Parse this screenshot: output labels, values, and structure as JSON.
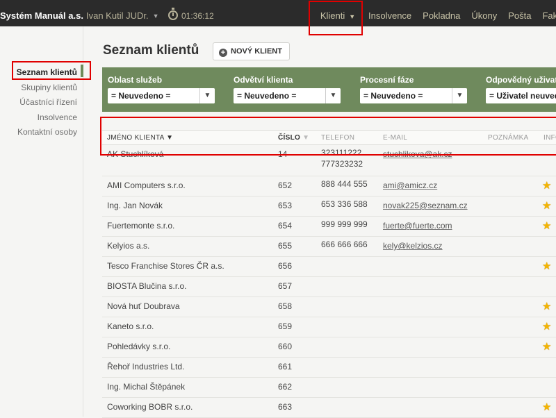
{
  "topbar": {
    "brand": "Systém Manuál a.s.",
    "user": "Ivan Kutil JUDr.",
    "timer": "01:36:12",
    "nav": [
      "Klienti",
      "Insolvence",
      "Pokladna",
      "Úkony",
      "Pošta",
      "Faktur"
    ]
  },
  "sidebar": {
    "items": [
      "Seznam klientů",
      "Skupiny klientů",
      "Účastníci řízení",
      "Insolvence",
      "Kontaktní osoby"
    ]
  },
  "main": {
    "title": "Seznam klientů",
    "new_button": "NOVÝ KLIENT"
  },
  "filters": [
    {
      "label": "Oblast služeb",
      "value": "= Neuvedeno ="
    },
    {
      "label": "Odvětví klienta",
      "value": "= Neuvedeno ="
    },
    {
      "label": "Procesní fáze",
      "value": "= Neuvedeno ="
    },
    {
      "label": "Odpovědný uživatel",
      "value": "= Uživatel neuvedeno"
    }
  ],
  "table": {
    "headers": {
      "name": "JMÉNO KLIENTA",
      "number": "ČÍSLO",
      "phone": "TELEFON",
      "email": "E-MAIL",
      "note": "POZNÁMKA",
      "info": "INFO"
    },
    "rows": [
      {
        "name": "AK Stuchlíková",
        "number": "14",
        "phone": "323111222",
        "phone2": "777323232",
        "email": "stuchlikova@ak.cz",
        "star": false
      },
      {
        "name": "AMI Computers s.r.o.",
        "number": "652",
        "phone": "888 444 555",
        "phone2": "",
        "email": "ami@amicz.cz",
        "star": true
      },
      {
        "name": "Ing. Jan Novák",
        "number": "653",
        "phone": "653 336 588",
        "phone2": "",
        "email": "novak225@seznam.cz",
        "star": true
      },
      {
        "name": "Fuertemonte s.r.o.",
        "number": "654",
        "phone": "999 999 999",
        "phone2": "",
        "email": "fuerte@fuerte.com",
        "star": true
      },
      {
        "name": "Kelyios a.s.",
        "number": "655",
        "phone": "666 666 666",
        "phone2": "",
        "email": "kely@kelzios.cz",
        "star": false
      },
      {
        "name": "Tesco Franchise Stores ČR a.s.",
        "number": "656",
        "phone": "",
        "phone2": "",
        "email": "",
        "star": true
      },
      {
        "name": "BIOSTA Blučina s.r.o.",
        "number": "657",
        "phone": "",
        "phone2": "",
        "email": "",
        "star": false
      },
      {
        "name": "Nová huť Doubrava",
        "number": "658",
        "phone": "",
        "phone2": "",
        "email": "",
        "star": true
      },
      {
        "name": "Kaneto s.r.o.",
        "number": "659",
        "phone": "",
        "phone2": "",
        "email": "",
        "star": true
      },
      {
        "name": "Pohledávky s.r.o.",
        "number": "660",
        "phone": "",
        "phone2": "",
        "email": "",
        "star": true
      },
      {
        "name": "Řehoř Industries Ltd.",
        "number": "661",
        "phone": "",
        "phone2": "",
        "email": "",
        "star": false
      },
      {
        "name": "Ing. Michal Štěpánek",
        "number": "662",
        "phone": "",
        "phone2": "",
        "email": "",
        "star": false
      },
      {
        "name": "Coworking BOBR s.r.o.",
        "number": "663",
        "phone": "",
        "phone2": "",
        "email": "",
        "star": true
      }
    ]
  },
  "colors": {
    "topbar": "#2b2b2b",
    "filter_panel": "#6f8a5d",
    "accent_bar": "#6d8b5a",
    "star": "#f4b400",
    "highlight": "#e00000"
  }
}
